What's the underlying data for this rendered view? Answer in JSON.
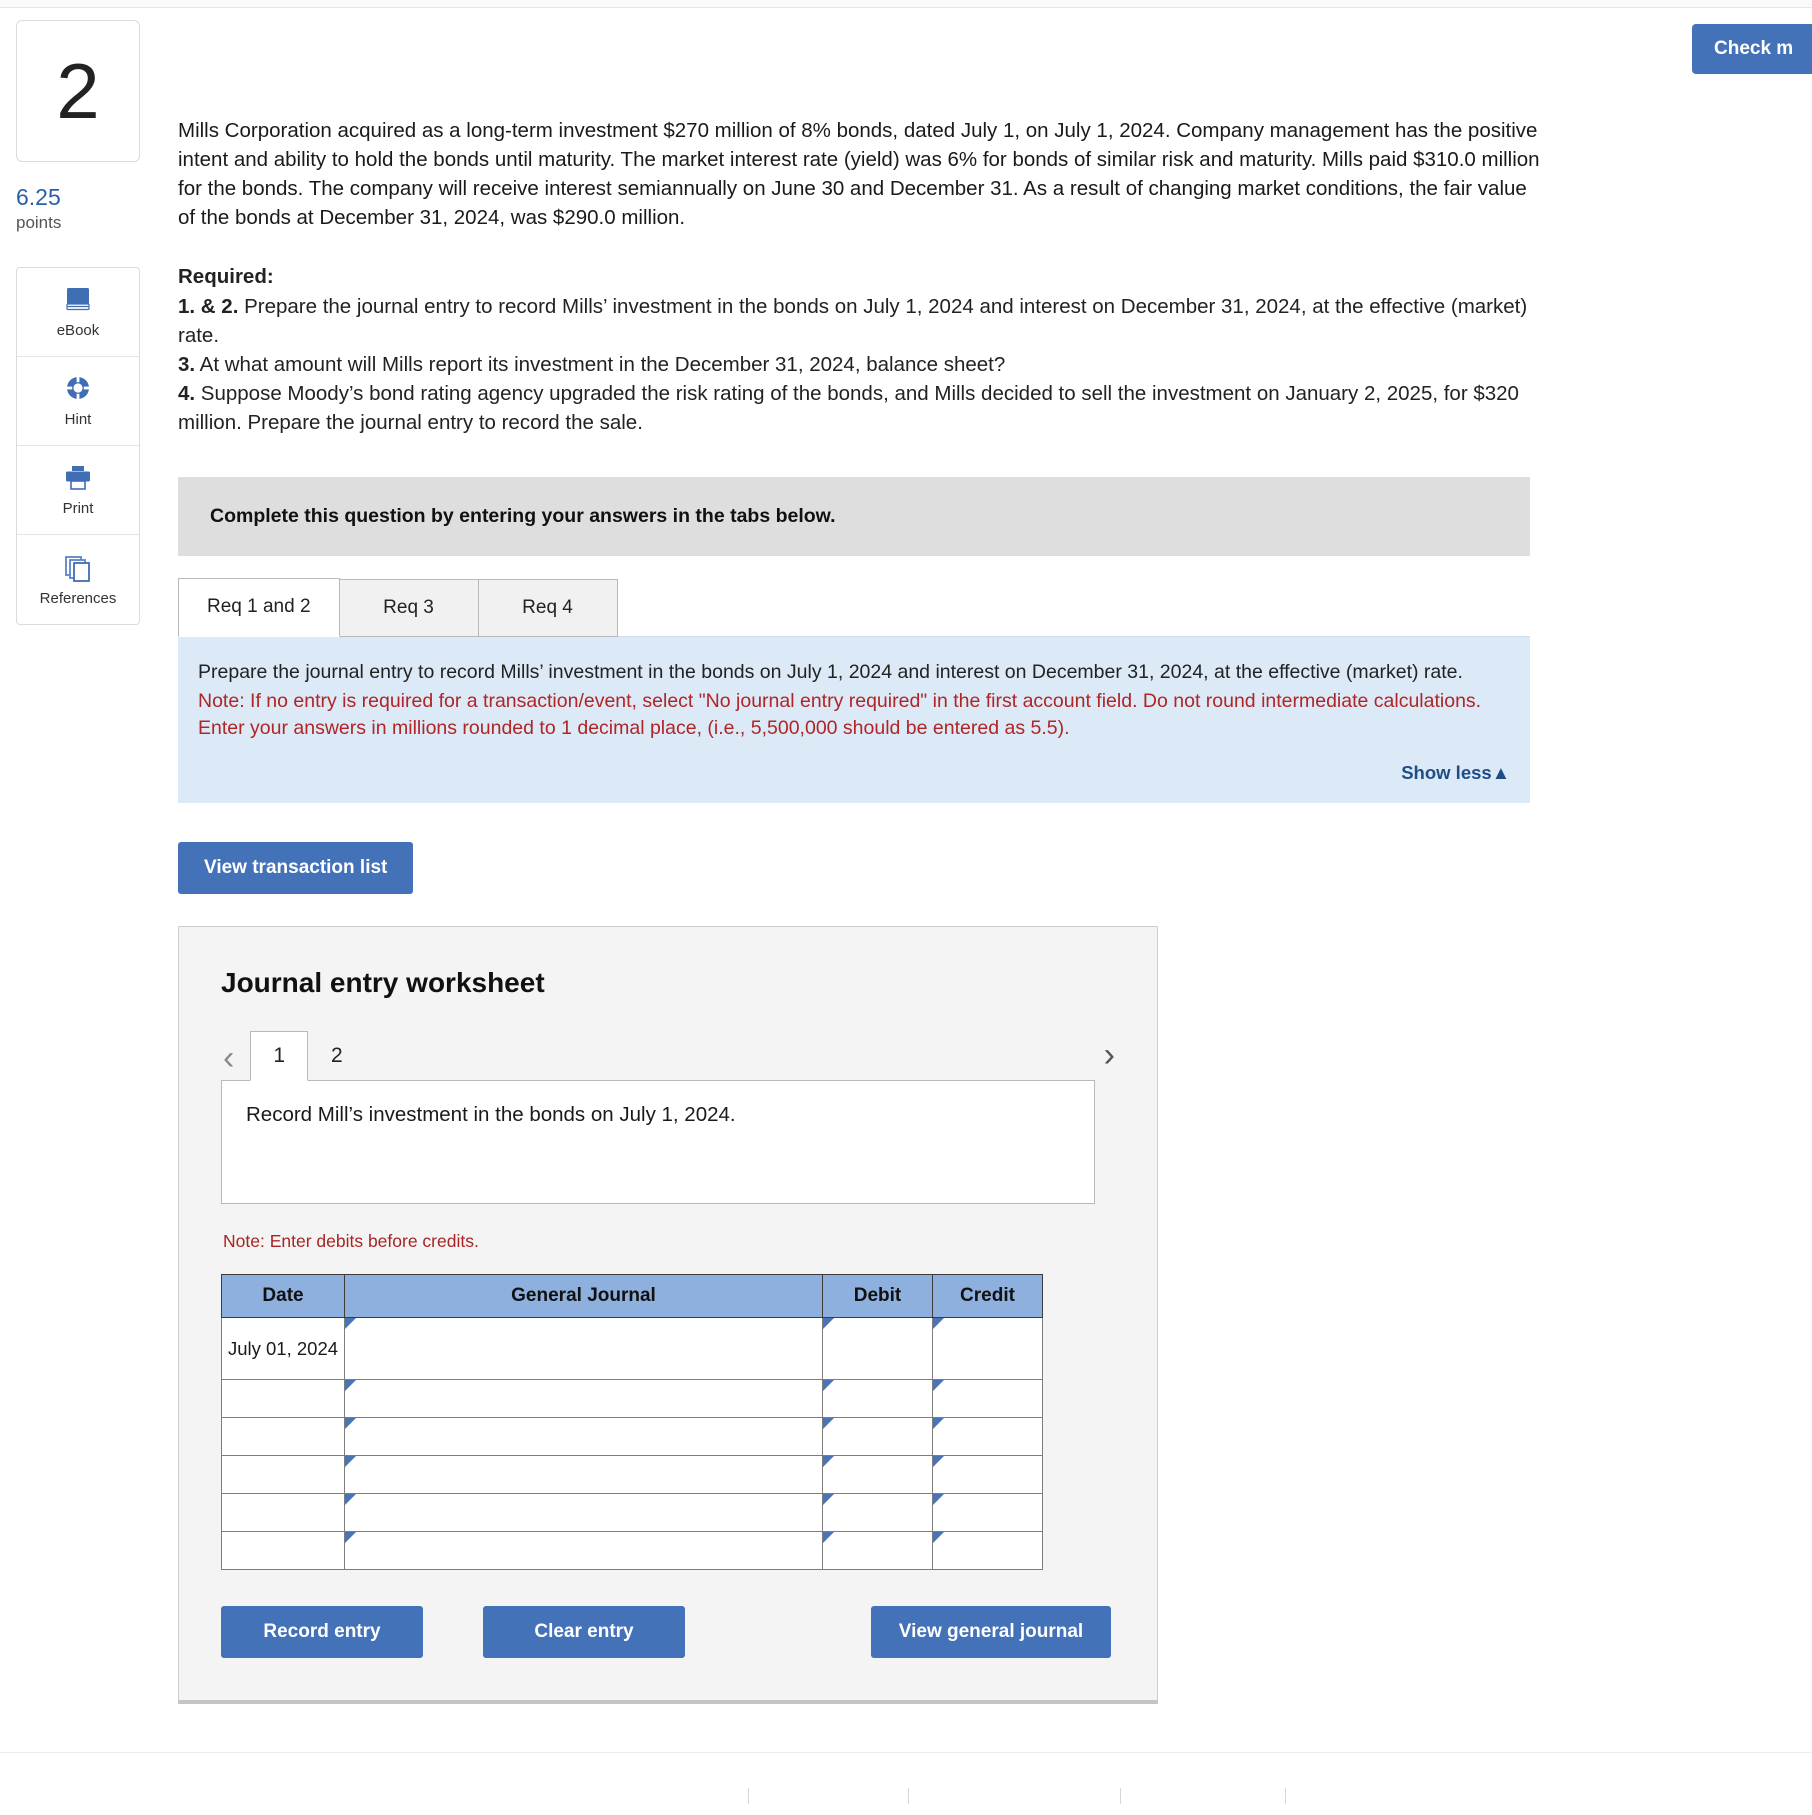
{
  "header": {
    "check_button_label": "Check m"
  },
  "rail": {
    "question_number": "2",
    "points_value": "6.25",
    "points_label": "points",
    "tools": [
      {
        "icon": "ebook-icon",
        "label": "eBook"
      },
      {
        "icon": "hint-icon",
        "label": "Hint"
      },
      {
        "icon": "print-icon",
        "label": "Print"
      },
      {
        "icon": "references-icon",
        "label": "References"
      }
    ]
  },
  "question": {
    "body": "Mills Corporation acquired as a long-term investment $270 million of 8% bonds, dated July 1, on July 1, 2024. Company management has the positive intent and ability to hold the bonds until maturity. The market interest rate (yield) was 6% for bonds of similar risk and maturity. Mills paid $310.0 million for the bonds. The company will receive interest semiannually on June 30 and December 31. As a result of changing market conditions, the fair value of the bonds at December 31, 2024, was $290.0 million.",
    "required_heading": "Required:",
    "requirements": [
      {
        "num": "1. & 2.",
        "text": " Prepare the journal entry to record Mills’ investment in the bonds on July 1, 2024 and interest on December 31, 2024, at the effective (market) rate."
      },
      {
        "num": "3.",
        "text": " At what amount will Mills report its investment in the December 31, 2024, balance sheet?"
      },
      {
        "num": "4.",
        "text": " Suppose Moody’s bond rating agency upgraded the risk rating of the bonds, and Mills decided to sell the investment on January 2, 2025, for $320 million. Prepare the journal entry to record the sale."
      }
    ],
    "banner": "Complete this question by entering your answers in the tabs below."
  },
  "tabs": [
    {
      "label": "Req 1 and 2",
      "active": true
    },
    {
      "label": "Req 3",
      "active": false
    },
    {
      "label": "Req 4",
      "active": false
    }
  ],
  "instructions": {
    "prompt": "Prepare the journal entry to record Mills’ investment in the bonds on July 1, 2024 and interest on December 31, 2024, at the effective (market) rate.",
    "note": "Note: If no entry is required for a transaction/event, select \"No journal entry required\" in the first account field. Do not round intermediate calculations. Enter your answers in millions rounded to 1 decimal place, (i.e., 5,500,000 should be entered as 5.5).",
    "show_less_label": "Show less",
    "show_less_caret": "▲"
  },
  "view_transaction_list_label": "View transaction list",
  "worksheet": {
    "title": "Journal entry worksheet",
    "prev_caret": "‹",
    "next_caret": "›",
    "pages": [
      {
        "label": "1",
        "active": true
      },
      {
        "label": "2",
        "active": false
      }
    ],
    "record_prompt": "Record Mill’s investment in the bonds on July 1, 2024.",
    "debit_note": "Note: Enter debits before credits.",
    "table": {
      "columns": [
        "Date",
        "General Journal",
        "Debit",
        "Credit"
      ],
      "rows": [
        {
          "date": "July 01, 2024",
          "general_journal": "",
          "debit": "",
          "credit": "",
          "tall": true
        },
        {
          "date": "",
          "general_journal": "",
          "debit": "",
          "credit": "",
          "tall": false
        },
        {
          "date": "",
          "general_journal": "",
          "debit": "",
          "credit": "",
          "tall": false
        },
        {
          "date": "",
          "general_journal": "",
          "debit": "",
          "credit": "",
          "tall": false
        },
        {
          "date": "",
          "general_journal": "",
          "debit": "",
          "credit": "",
          "tall": false
        },
        {
          "date": "",
          "general_journal": "",
          "debit": "",
          "credit": "",
          "tall": false
        }
      ]
    },
    "buttons": {
      "record_entry": "Record entry",
      "clear_entry": "Clear entry",
      "view_general_journal": "View general journal"
    }
  },
  "colors": {
    "accent_blue": "#4472b8",
    "panel_blue": "#dce9f7",
    "table_header_blue": "#8eb0de",
    "note_red": "#b02525",
    "points_blue": "#2b5fa5"
  }
}
